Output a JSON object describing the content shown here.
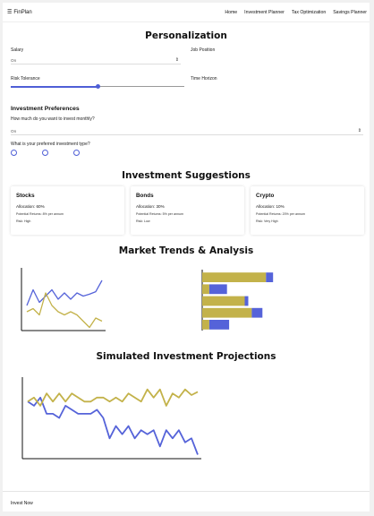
{
  "brand": {
    "icon": "bars-icon",
    "name": "FinPlan"
  },
  "nav": {
    "links": [
      "Home",
      "Investment Planner",
      "Tax Optimization",
      "Savings Planner"
    ]
  },
  "personalization": {
    "title": "Personalization",
    "salary": {
      "label": "Salary",
      "value": "On"
    },
    "job_position": {
      "label": "Job Position"
    },
    "risk_tolerance": {
      "label": "Risk Tolerance",
      "level": 0.5
    },
    "time_horizon": {
      "label": "Time Horizon"
    }
  },
  "preferences": {
    "title": "Investment Preferences",
    "monthly_question": "How much do you want to invest monthly?",
    "monthly_value": "On",
    "type_question": "What is your preferred investment type?",
    "type_options_count": 3
  },
  "suggestions": {
    "title": "Investment Suggestions",
    "cards": [
      {
        "title": "Stocks",
        "allocation": "Allocation: 60%",
        "returns": "Potential Returns: 8% per annum",
        "risk": "Risk: High"
      },
      {
        "title": "Bonds",
        "allocation": "Allocation: 30%",
        "returns": "Potential Returns: 5% per annum",
        "risk": "Risk: Low"
      },
      {
        "title": "Crypto",
        "allocation": "Allocation: 10%",
        "returns": "Potential Returns: 20% per annum",
        "risk": "Risk: Very High"
      }
    ]
  },
  "market": {
    "title": "Market Trends & Analysis"
  },
  "simulation": {
    "title": "Simulated Investment Projections"
  },
  "footer": {
    "invest_label": "Invest Now"
  },
  "colors": {
    "primary": "#5563d9",
    "secondary": "#c3b24a",
    "axis": "#111111"
  },
  "chart_data": [
    {
      "type": "line",
      "series": [
        {
          "values": [
            40,
            65,
            45,
            55,
            65,
            50,
            60,
            50,
            60,
            55,
            58,
            62,
            80
          ]
        },
        {
          "values": [
            30,
            35,
            25,
            60,
            40,
            30,
            25,
            30,
            25,
            15,
            5,
            20,
            15
          ]
        }
      ],
      "ylim": [
        0,
        100
      ],
      "grid": false
    },
    {
      "type": "bar",
      "orientation": "horizontal",
      "series": [
        {
          "values": [
            10,
            25,
            5,
            15,
            28
          ]
        },
        {
          "values": [
            90,
            10,
            60,
            70,
            10
          ]
        }
      ],
      "xlim": [
        0,
        120
      ],
      "grid": false
    },
    {
      "type": "line",
      "series": [
        {
          "values": [
            70,
            65,
            75,
            55,
            55,
            50,
            65,
            60,
            55,
            55,
            55,
            60,
            50,
            25,
            40,
            30,
            40,
            25,
            35,
            30,
            35,
            15,
            35,
            25,
            35,
            20,
            25,
            5
          ]
        },
        {
          "values": [
            70,
            75,
            65,
            80,
            70,
            80,
            70,
            80,
            75,
            70,
            70,
            75,
            75,
            70,
            75,
            70,
            80,
            75,
            70,
            85,
            75,
            85,
            65,
            80,
            75,
            85,
            78,
            82
          ]
        }
      ],
      "ylim": [
        0,
        100
      ],
      "grid": false
    }
  ]
}
